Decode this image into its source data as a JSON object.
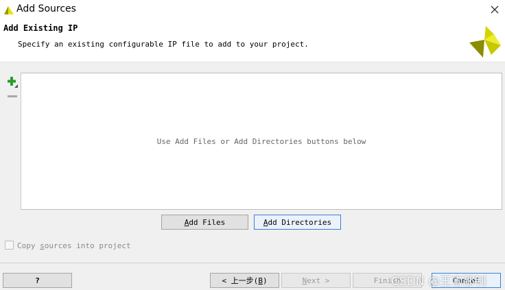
{
  "window": {
    "title": "Add Sources",
    "close_icon": "close-icon"
  },
  "header": {
    "title": "Add Existing IP",
    "description": "Specify an existing configurable IP file to add to your project."
  },
  "list": {
    "placeholder": "Use Add Files or Add Directories buttons below",
    "add_icon": "plus-icon",
    "remove_icon": "minus-icon"
  },
  "actions": {
    "add_files": {
      "hotkey": "A",
      "rest": "dd Files"
    },
    "add_directories": {
      "hotkey": "A",
      "rest": "dd Directories"
    }
  },
  "options": {
    "copy_sources": {
      "pre": "Copy ",
      "hotkey": "s",
      "post": "ources into project",
      "checked": false
    }
  },
  "footer": {
    "help": "?",
    "back": {
      "pre": "< 上一步(",
      "hotkey": "B",
      "post": ")"
    },
    "next": {
      "hotkey": "N",
      "rest": "ext >"
    },
    "finish": "Finish",
    "cancel": "Cancel"
  },
  "watermark": "CSDN @王言邵钊",
  "colors": {
    "accent": "#3c7fd1",
    "logo_yellow": "#c8c800",
    "logo_olive": "#8a8a00",
    "add_green": "#2a9d2a"
  }
}
